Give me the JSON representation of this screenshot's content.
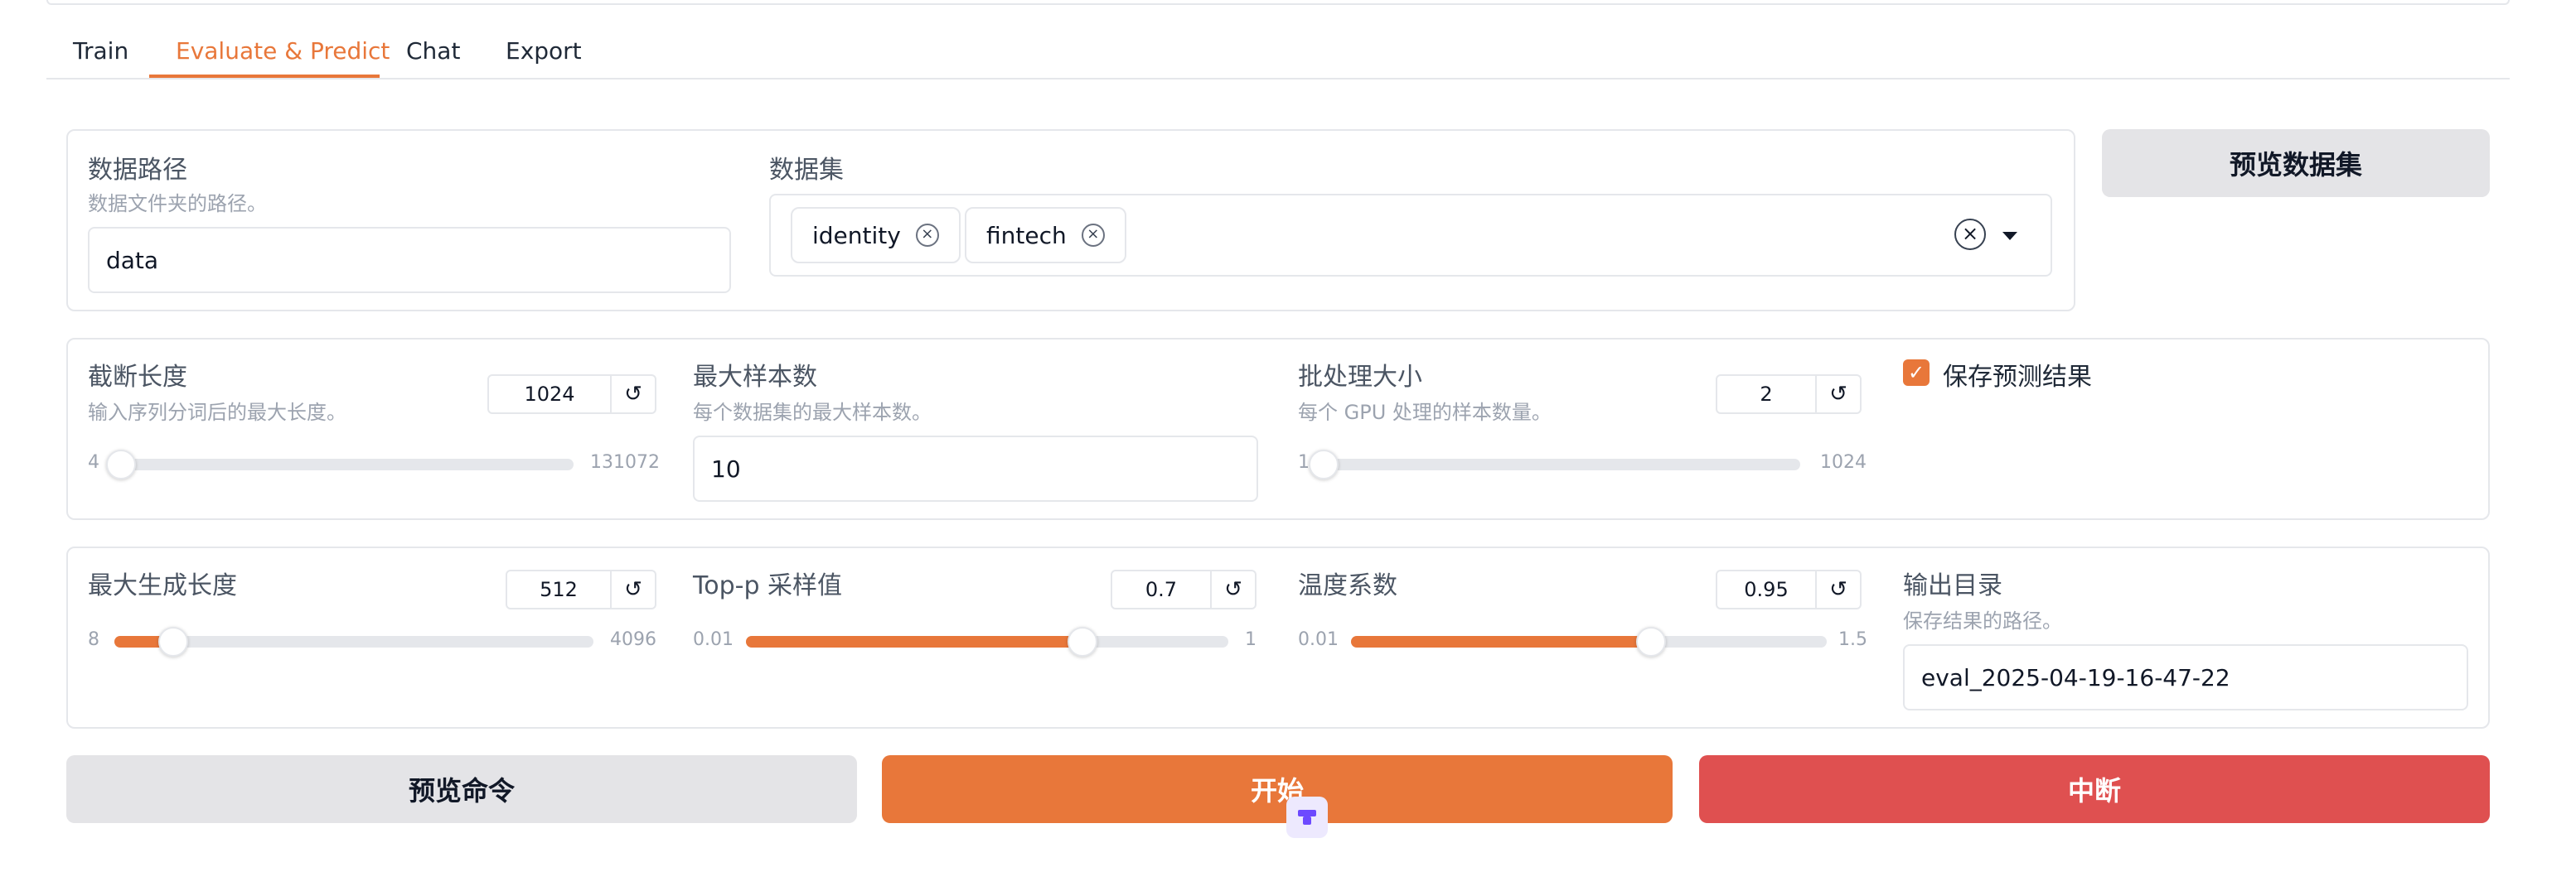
{
  "tabs": [
    {
      "label": "Train",
      "active": false
    },
    {
      "label": "Evaluate & Predict",
      "active": true
    },
    {
      "label": "Chat",
      "active": false
    },
    {
      "label": "Export",
      "active": false
    }
  ],
  "data_path": {
    "label": "数据路径",
    "info": "数据文件夹的路径。",
    "value": "data"
  },
  "dataset": {
    "label": "数据集",
    "selected": [
      "identity",
      "fintech"
    ],
    "clear_icon": "clear-all-icon",
    "dropdown_icon": "caret-down-icon"
  },
  "preview_dataset_button": "预览数据集",
  "cutoff_len": {
    "label": "截断长度",
    "info": "输入序列分词后的最大长度。",
    "value": "1024",
    "min": "4",
    "max": "131072",
    "fraction": 0.008
  },
  "max_samples": {
    "label": "最大样本数",
    "info": "每个数据集的最大样本数。",
    "value": "10"
  },
  "batch_size": {
    "label": "批处理大小",
    "info": "每个 GPU 处理的样本数量。",
    "value": "2",
    "min": "1",
    "max": "1024",
    "fraction": 0.001
  },
  "predict": {
    "label": "保存预测结果",
    "checked": true
  },
  "max_new_tokens": {
    "label": "最大生成长度",
    "value": "512",
    "min": "8",
    "max": "4096",
    "fraction": 0.123
  },
  "top_p": {
    "label": "Top-p 采样值",
    "value": "0.7",
    "min": "0.01",
    "max": "1",
    "fraction": 0.697
  },
  "temperature": {
    "label": "温度系数",
    "value": "0.95",
    "min": "0.01",
    "max": "1.5",
    "fraction": 0.631
  },
  "output_dir": {
    "label": "输出目录",
    "info": "保存结果的路径。",
    "value": "eval_2025-04-19-16-47-22"
  },
  "buttons": {
    "preview_command": "预览命令",
    "start": "开始",
    "abort": "中断"
  },
  "colors": {
    "accent": "#e8773a",
    "danger": "#df5050",
    "neutral_button": "#e4e4e7"
  },
  "reset_icon": "reset-icon"
}
